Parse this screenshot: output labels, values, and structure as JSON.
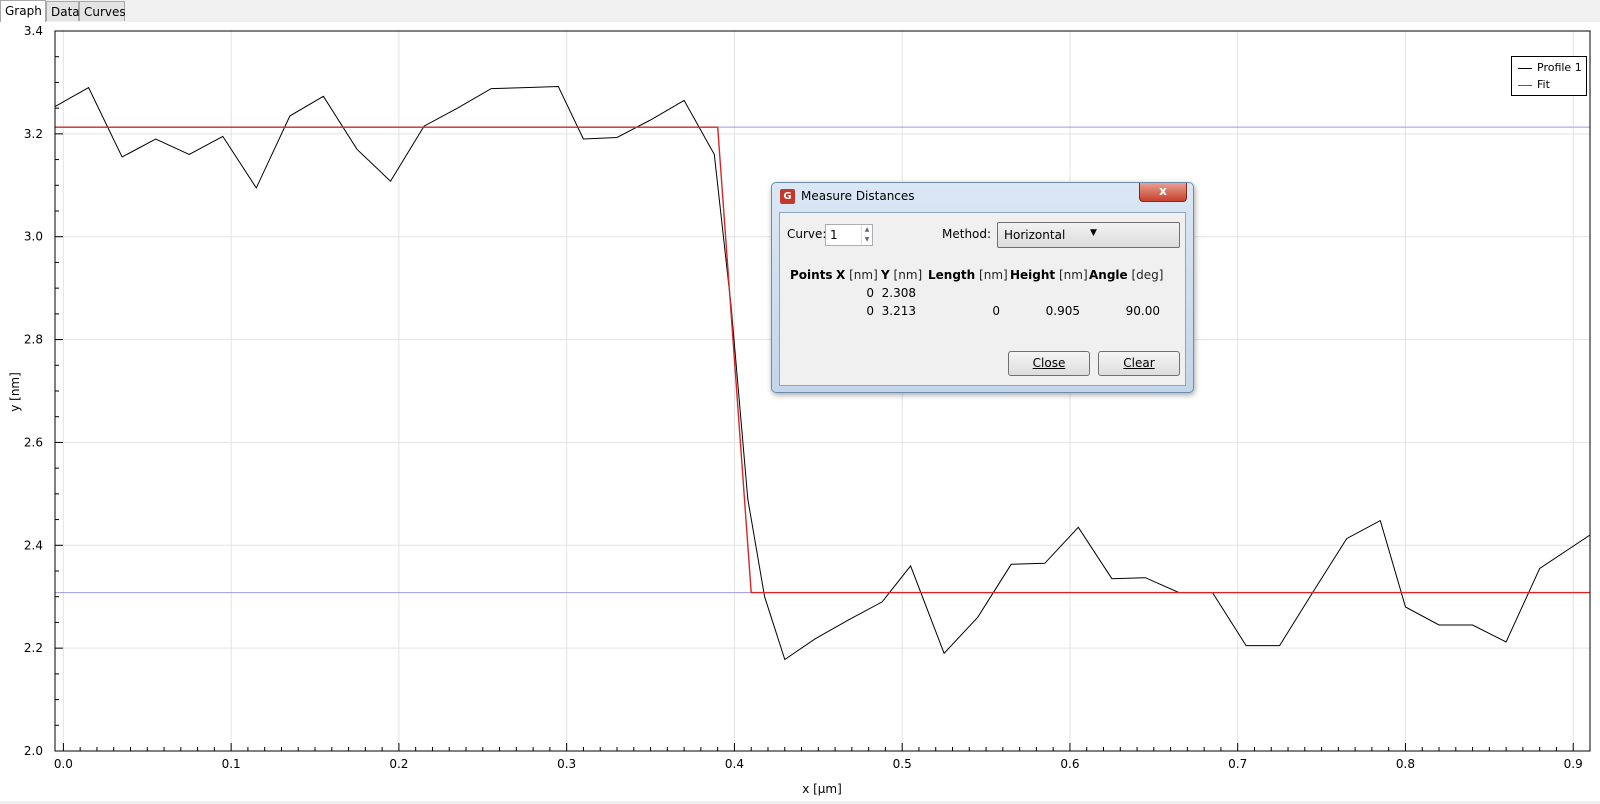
{
  "tabs": [
    "Graph",
    "Data",
    "Curves"
  ],
  "legend": [
    {
      "label": "Profile 1",
      "color": "#000000"
    },
    {
      "label": "Fit",
      "color": "#d62728"
    }
  ],
  "chart_data": {
    "type": "line",
    "xlabel": "x [µm]",
    "ylabel": "y [nm]",
    "xlim": [
      -0.005,
      0.91
    ],
    "ylim": [
      2.0,
      3.4
    ],
    "xticks": [
      0.0,
      0.1,
      0.2,
      0.3,
      0.4,
      0.5,
      0.6,
      0.7,
      0.8,
      0.9
    ],
    "xtick_labels": [
      "0.0",
      "0.1",
      "0.2",
      "0.3",
      "0.4",
      "0.5",
      "0.6",
      "0.7",
      "0.8",
      "0.9"
    ],
    "yticks": [
      2.0,
      2.2,
      2.4,
      2.6,
      2.8,
      3.0,
      3.2,
      3.4
    ],
    "ytick_labels": [
      "2.0",
      "2.2",
      "2.4",
      "2.6",
      "2.8",
      "3.0",
      "3.2",
      "3.4"
    ],
    "grid": true,
    "legend_position": "top-right",
    "series": [
      {
        "name": "Profile 1",
        "color": "#000000",
        "x": [
          -0.005,
          0.015,
          0.035,
          0.055,
          0.075,
          0.095,
          0.115,
          0.135,
          0.155,
          0.175,
          0.195,
          0.215,
          0.235,
          0.255,
          0.275,
          0.295,
          0.31,
          0.33,
          0.35,
          0.37,
          0.388,
          0.398,
          0.408,
          0.418,
          0.43,
          0.448,
          0.468,
          0.488,
          0.505,
          0.525,
          0.545,
          0.565,
          0.585,
          0.605,
          0.625,
          0.645,
          0.665,
          0.685,
          0.705,
          0.725,
          0.745,
          0.765,
          0.785,
          0.8,
          0.82,
          0.84,
          0.86,
          0.88,
          0.91
        ],
        "y": [
          3.253,
          3.29,
          3.155,
          3.19,
          3.16,
          3.195,
          3.095,
          3.235,
          3.273,
          3.17,
          3.108,
          3.215,
          3.25,
          3.288,
          3.29,
          3.292,
          3.19,
          3.193,
          3.227,
          3.265,
          3.16,
          2.865,
          2.49,
          2.3,
          2.178,
          2.218,
          2.255,
          2.29,
          2.36,
          2.19,
          2.26,
          2.363,
          2.365,
          2.435,
          2.335,
          2.337,
          2.308,
          2.308,
          2.205,
          2.205,
          2.31,
          2.413,
          2.448,
          2.28,
          2.245,
          2.245,
          2.212,
          2.355,
          2.42
        ]
      },
      {
        "name": "Fit",
        "color": "#d62728",
        "x": [
          -0.005,
          0.39,
          0.41,
          0.91
        ],
        "y": [
          3.213,
          3.213,
          2.308,
          2.308
        ]
      }
    ],
    "reference_lines": [
      {
        "y": 3.213,
        "color": "#9b9bdf"
      },
      {
        "y": 2.308,
        "color": "#9b9bdf"
      }
    ]
  },
  "dialog": {
    "title": "Measure Distances",
    "close_glyph": "x",
    "curve_label": "Curve:",
    "curve_value": "1",
    "method_label": "Method:",
    "method_value": "Horizontal",
    "columns": [
      {
        "name": "Points",
        "unit": ""
      },
      {
        "name": "X",
        "unit": "[nm]"
      },
      {
        "name": "Y",
        "unit": "[nm]"
      },
      {
        "name": "Length",
        "unit": "[nm]"
      },
      {
        "name": "Height",
        "unit": "[nm]"
      },
      {
        "name": "Angle",
        "unit": "[deg]"
      }
    ],
    "rows": [
      {
        "x": "0",
        "y": "2.308",
        "length": "",
        "height": "",
        "angle": ""
      },
      {
        "x": "0",
        "y": "3.213",
        "length": "0",
        "height": "0.905",
        "angle": "90.00"
      }
    ],
    "close_button": "Close",
    "clear_button": "Clear"
  }
}
